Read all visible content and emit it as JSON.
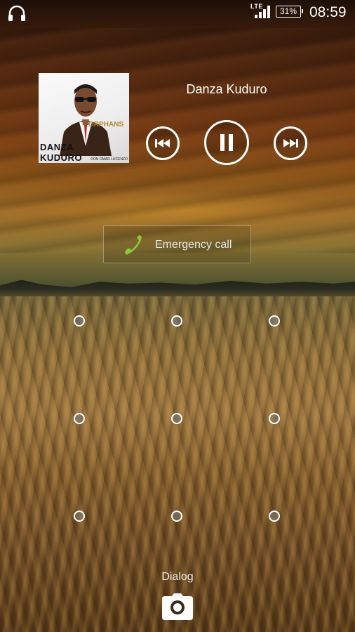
{
  "status_bar": {
    "network": "LTE",
    "battery": "31%",
    "time": "08:59",
    "icons": [
      "headphones-icon",
      "signal-icon",
      "battery-icon"
    ]
  },
  "media": {
    "song_title": "Danza Kuduro",
    "album_art": {
      "title": "DANZA KUDURO",
      "subtitle": "ORPHANS",
      "credit": "DON OMAR LUCENZO"
    },
    "controls": {
      "previous": "previous-track-icon",
      "pause": "pause-icon",
      "next": "next-track-icon"
    }
  },
  "emergency": {
    "label": "Emergency call",
    "icon": "phone-icon",
    "icon_color": "#8ec63f"
  },
  "pattern_lock": {
    "rows": 3,
    "cols": 3
  },
  "bottom": {
    "label": "Dialog",
    "icon": "camera-icon"
  }
}
